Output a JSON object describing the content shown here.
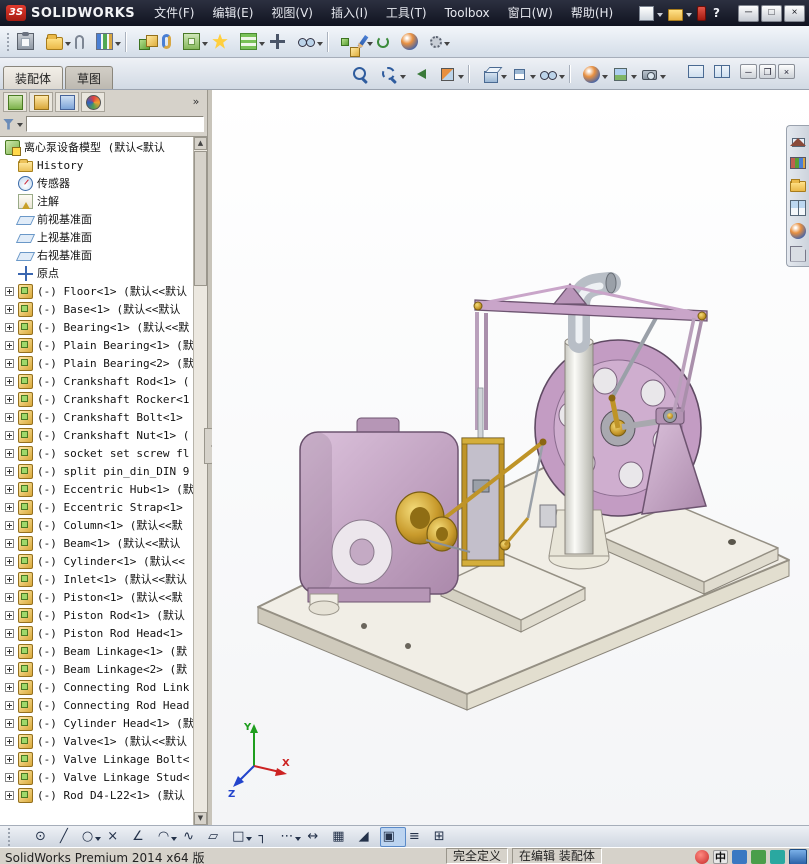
{
  "titlebar": {
    "logo_mark": "3S",
    "logo_text": "SOLIDWORKS",
    "menus": [
      "文件(F)",
      "编辑(E)",
      "视图(V)",
      "插入(I)",
      "工具(T)",
      "Toolbox",
      "窗口(W)",
      "帮助(H)"
    ],
    "help_glyph": "?",
    "window_controls": [
      {
        "name": "minimize-button",
        "glyph": "─"
      },
      {
        "name": "maximize-button",
        "glyph": "□"
      },
      {
        "name": "close-button",
        "glyph": "×"
      }
    ]
  },
  "main_toolbar": {
    "icons": [
      {
        "name": "paste-icon",
        "cls": "g-clipboard"
      },
      {
        "name": "open-document-icon",
        "cls": "g-folder",
        "arrow": true
      },
      {
        "name": "attachment-icon",
        "cls": "g-clip"
      },
      {
        "name": "component-columns-icon",
        "cls": "g-cols",
        "arrow": true
      },
      {
        "name": "separator",
        "cls": "sep"
      },
      {
        "name": "insert-components-icon",
        "cls": "g-cube2",
        "arrow": true
      },
      {
        "name": "mate-icon",
        "cls": "g-mate"
      },
      {
        "name": "assembly-features-icon",
        "cls": "g-cubefolder",
        "arrow": true
      },
      {
        "name": "smart-fasteners-icon",
        "cls": "g-star"
      },
      {
        "name": "linear-component-pattern-icon",
        "cls": "g-grid",
        "arrow": true
      },
      {
        "name": "move-component-icon",
        "cls": "g-move"
      },
      {
        "name": "show-hidden-components-icon",
        "cls": "g-glasses2",
        "arrow": true
      },
      {
        "name": "separator",
        "cls": "sep"
      },
      {
        "name": "exploded-view-icon",
        "cls": "g-explode"
      },
      {
        "name": "sketch-icon",
        "cls": "g-pencil",
        "arrow": true
      },
      {
        "name": "rebuild-icon",
        "cls": "g-update"
      },
      {
        "name": "edit-appearance-icon",
        "cls": "g-ball"
      },
      {
        "name": "options-gear-icon",
        "cls": "g-gear",
        "arrow": true
      }
    ]
  },
  "left_panel": {
    "command_tabs": [
      {
        "label": "装配体",
        "active": true
      },
      {
        "label": "草图",
        "active": false
      }
    ],
    "manager_tabs": [
      {
        "name": "featuremanager-tree-tab-icon",
        "cls": "t-fm"
      },
      {
        "name": "propertymanager-tab-icon",
        "cls": "t-pm"
      },
      {
        "name": "configurationmanager-tab-icon",
        "cls": "t-cm"
      },
      {
        "name": "displaymanager-tab-icon",
        "cls": "t-dm"
      }
    ],
    "tree_root": {
      "icon": "assembly-icon",
      "cls": "assembly",
      "label": "离心泵设备模型 (默认<默认"
    },
    "tree_items": [
      {
        "exp": false,
        "cls": "folder",
        "icon": "history-folder-icon",
        "label": "History"
      },
      {
        "exp": false,
        "cls": "sensors",
        "icon": "sensors-icon",
        "label": "传感器"
      },
      {
        "exp": false,
        "cls": "ann",
        "icon": "annotations-icon",
        "label": "注解"
      },
      {
        "exp": false,
        "cls": "plane",
        "icon": "front-plane-icon",
        "label": "前视基准面"
      },
      {
        "exp": false,
        "cls": "plane",
        "icon": "top-plane-icon",
        "label": "上视基准面"
      },
      {
        "exp": false,
        "cls": "plane",
        "icon": "right-plane-icon",
        "label": "右视基准面"
      },
      {
        "exp": false,
        "cls": "origin",
        "icon": "origin-icon",
        "label": "原点"
      },
      {
        "exp": true,
        "cls": "part",
        "icon": "component-icon",
        "label": "(-) Floor<1> (默认<<默认"
      },
      {
        "exp": true,
        "cls": "part",
        "icon": "component-icon",
        "label": "(-) Base<1> (默认<<默认"
      },
      {
        "exp": true,
        "cls": "part",
        "icon": "component-icon",
        "label": "(-) Bearing<1> (默认<<默"
      },
      {
        "exp": true,
        "cls": "part",
        "icon": "component-icon",
        "label": "(-) Plain Bearing<1> (默"
      },
      {
        "exp": true,
        "cls": "part",
        "icon": "component-icon",
        "label": "(-) Plain Bearing<2> (默"
      },
      {
        "exp": true,
        "cls": "part",
        "icon": "component-icon",
        "label": "(-) Crankshaft Rod<1> ("
      },
      {
        "exp": true,
        "cls": "part",
        "icon": "component-icon",
        "label": "(-) Crankshaft Rocker<1"
      },
      {
        "exp": true,
        "cls": "part",
        "icon": "component-icon",
        "label": "(-) Crankshaft Bolt<1>"
      },
      {
        "exp": true,
        "cls": "part",
        "icon": "component-icon",
        "label": "(-) Crankshaft Nut<1> ("
      },
      {
        "exp": true,
        "cls": "part",
        "icon": "component-icon",
        "label": "(-) socket set screw fl"
      },
      {
        "exp": true,
        "cls": "part",
        "icon": "component-icon",
        "label": "(-) split pin_din_DIN 9"
      },
      {
        "exp": true,
        "cls": "part",
        "icon": "component-icon",
        "label": "(-) Eccentric Hub<1> (默"
      },
      {
        "exp": true,
        "cls": "part",
        "icon": "component-icon",
        "label": "(-) Eccentric Strap<1>"
      },
      {
        "exp": true,
        "cls": "part",
        "icon": "component-icon",
        "label": "(-) Column<1> (默认<<默"
      },
      {
        "exp": true,
        "cls": "part",
        "icon": "component-icon",
        "label": "(-) Beam<1> (默认<<默认"
      },
      {
        "exp": true,
        "cls": "part",
        "icon": "component-icon",
        "label": "(-) Cylinder<1> (默认<<"
      },
      {
        "exp": true,
        "cls": "part",
        "icon": "component-icon",
        "label": "(-) Inlet<1> (默认<<默认"
      },
      {
        "exp": true,
        "cls": "part",
        "icon": "component-icon",
        "label": "(-) Piston<1> (默认<<默"
      },
      {
        "exp": true,
        "cls": "part",
        "icon": "component-icon",
        "label": "(-) Piston Rod<1> (默认"
      },
      {
        "exp": true,
        "cls": "part",
        "icon": "component-icon",
        "label": "(-) Piston Rod Head<1>"
      },
      {
        "exp": true,
        "cls": "part",
        "icon": "component-icon",
        "label": "(-) Beam Linkage<1> (默"
      },
      {
        "exp": true,
        "cls": "part",
        "icon": "component-icon",
        "label": "(-) Beam Linkage<2> (默"
      },
      {
        "exp": true,
        "cls": "part",
        "icon": "component-icon",
        "label": "(-) Connecting Rod Link"
      },
      {
        "exp": true,
        "cls": "part",
        "icon": "component-icon",
        "label": "(-) Connecting Rod Head"
      },
      {
        "exp": true,
        "cls": "part",
        "icon": "component-icon",
        "label": "(-) Cylinder Head<1> (默"
      },
      {
        "exp": true,
        "cls": "part",
        "icon": "component-icon",
        "label": "(-) Valve<1> (默认<<默认"
      },
      {
        "exp": true,
        "cls": "part",
        "icon": "component-icon",
        "label": "(-) Valve Linkage Bolt<"
      },
      {
        "exp": true,
        "cls": "part",
        "icon": "component-icon",
        "label": "(-) Valve Linkage Stud<"
      },
      {
        "exp": true,
        "cls": "part",
        "icon": "component-icon",
        "label": "(-) Rod D4-L22<1> (默认"
      }
    ]
  },
  "viewport": {
    "hud_icons": [
      {
        "name": "zoom-fit-icon",
        "cls": "h-mag"
      },
      {
        "name": "zoom-area-icon",
        "cls": "h-magbox",
        "arrow": true
      },
      {
        "name": "previous-view-icon",
        "cls": "h-prev"
      },
      {
        "name": "section-view-icon",
        "cls": "h-section",
        "arrow": true
      },
      {
        "name": "separator",
        "cls": "hsep"
      },
      {
        "name": "view-orientation-icon",
        "cls": "h-cube",
        "arrow": true
      },
      {
        "name": "display-style-icon",
        "cls": "h-style",
        "arrow": true
      },
      {
        "name": "hide-show-items-icon",
        "cls": "h-glasses",
        "arrow": true
      },
      {
        "name": "separator",
        "cls": "hsep"
      },
      {
        "name": "edit-appearance-icon",
        "cls": "h-ball",
        "arrow": true
      },
      {
        "name": "apply-scene-icon",
        "cls": "h-scene",
        "arrow": true
      },
      {
        "name": "view-settings-icon",
        "cls": "h-camera",
        "arrow": true
      }
    ],
    "pane_toggles": [
      {
        "name": "split-pane-icon",
        "cls": "pt-a"
      },
      {
        "name": "pane-layout-icon",
        "cls": "pt-b"
      }
    ],
    "doc_controls": [
      {
        "name": "minimize-document-button",
        "glyph": "─"
      },
      {
        "name": "restore-document-button",
        "glyph": "❐"
      },
      {
        "name": "close-document-button",
        "glyph": "×"
      }
    ],
    "task_pane_icons": [
      {
        "name": "resources-home-icon",
        "cls": "tp-home"
      },
      {
        "name": "design-library-icon",
        "cls": "tp-lib"
      },
      {
        "name": "file-explorer-icon",
        "cls": "tp-folder"
      },
      {
        "name": "view-palette-icon",
        "cls": "tp-palette"
      },
      {
        "name": "appearances-scenes-icon",
        "cls": "tp-ball"
      },
      {
        "name": "custom-properties-icon",
        "cls": "tp-props"
      }
    ],
    "triad": {
      "x": "X",
      "y": "Y",
      "z": "Z"
    }
  },
  "sketch_toolbar": {
    "icons": [
      {
        "name": "sketch-point-icon",
        "glyph": "⊙"
      },
      {
        "name": "line-icon",
        "glyph": "╱"
      },
      {
        "name": "circle-icon",
        "glyph": "○",
        "arrow": true
      },
      {
        "name": "trim-entities-icon",
        "glyph": "×"
      },
      {
        "name": "sketch-chamfer-icon",
        "glyph": "∠"
      },
      {
        "name": "arc-icon",
        "glyph": "◠",
        "arrow": true
      },
      {
        "name": "spline-icon",
        "glyph": "∿"
      },
      {
        "name": "sketch-edit-icon",
        "glyph": "▱"
      },
      {
        "name": "rectangle-icon",
        "glyph": "□",
        "arrow": true
      },
      {
        "name": "corner-rectangle-icon",
        "glyph": "┐"
      },
      {
        "name": "linear-sketch-pattern-icon",
        "glyph": "⋯",
        "arrow": true
      },
      {
        "name": "smart-dimension-icon",
        "glyph": "↔"
      },
      {
        "name": "mirror-entities-icon",
        "glyph": "▦"
      },
      {
        "name": "convert-entities-icon",
        "glyph": "◢"
      },
      {
        "name": "offset-entities-icon",
        "glyph": "▣",
        "active": true
      },
      {
        "name": "grid-snap-icon",
        "glyph": "≡"
      },
      {
        "name": "table-icon",
        "glyph": "⊞"
      }
    ]
  },
  "statusbar": {
    "product": "SolidWorks Premium 2014 x64 版",
    "defined_state": "完全定义",
    "editing_state": "在编辑 装配体",
    "taskbar_icons": [
      {
        "name": "ime-red-icon",
        "cls": "tb-red",
        "glyph": ""
      },
      {
        "name": "ime-language-icon",
        "cls": "tb-lang",
        "glyph": "中"
      },
      {
        "name": "tray-icon-blue",
        "cls": "tb-blue",
        "glyph": ""
      },
      {
        "name": "tray-icon-green",
        "cls": "tb-green",
        "glyph": ""
      },
      {
        "name": "tray-icon-teal",
        "cls": "tb-teal",
        "glyph": ""
      },
      {
        "name": "show-desktop-icon",
        "cls": "tb-corner",
        "glyph": ""
      }
    ]
  },
  "colors": {
    "lavender": "#c8a2c8",
    "brass": "#bf9428",
    "titlebar_dark": "#14161f",
    "chrome_panel": "#d6d2ca",
    "toolbar_blue": "#d4dde8"
  }
}
